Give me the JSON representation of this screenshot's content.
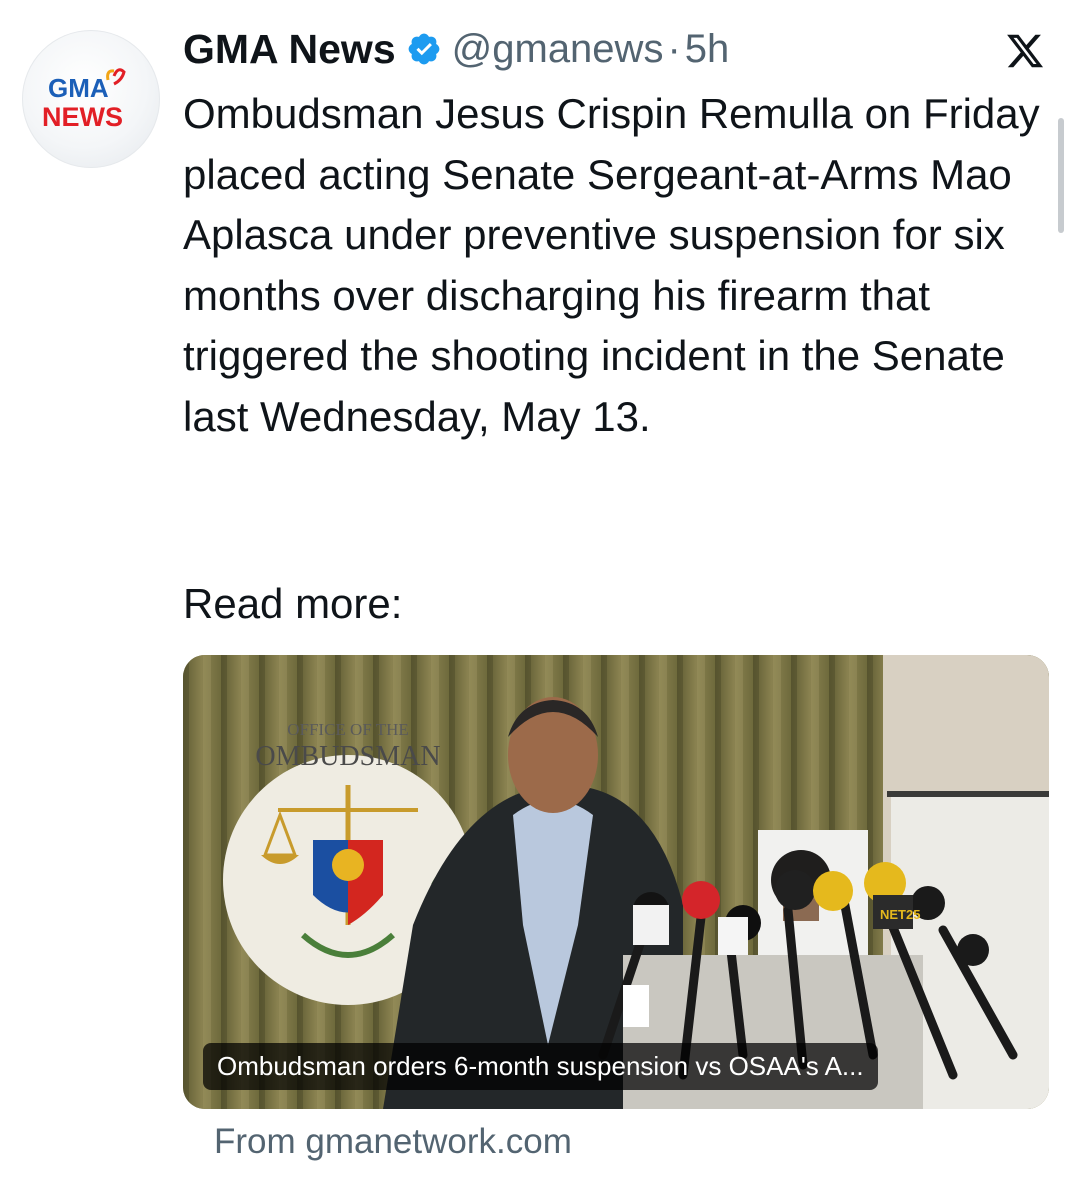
{
  "tweet": {
    "author_name": "GMA News",
    "handle": "@gmanews",
    "separator": "·",
    "time_ago": "5h",
    "verified": true,
    "avatar": {
      "logo_line1": "GMA",
      "logo_line2": "NEWS"
    },
    "text": "Ombudsman Jesus Crispin Remulla on Friday placed acting Senate Sergeant-at-Arms Mao Aplasca under preventive suspension for six months over discharging his firearm that triggered the shooting incident in the Senate last Wednesday, May 13.",
    "read_more": "Read more:",
    "platform_icon": "x-logo-icon"
  },
  "link_card": {
    "caption": "Ombudsman orders 6-month suspension vs OSAA's A...",
    "source": "From gmanetwork.com",
    "image": {
      "seal_text_top": "OFFICE OF THE",
      "seal_text_main": "OMBUDSMAN",
      "mic_label": "NET25"
    }
  },
  "colors": {
    "text_primary": "#0f1419",
    "text_secondary": "#536471",
    "verified_blue": "#1d9bf0",
    "gma_blue": "#1b5fb8",
    "gma_red": "#e21f26"
  }
}
